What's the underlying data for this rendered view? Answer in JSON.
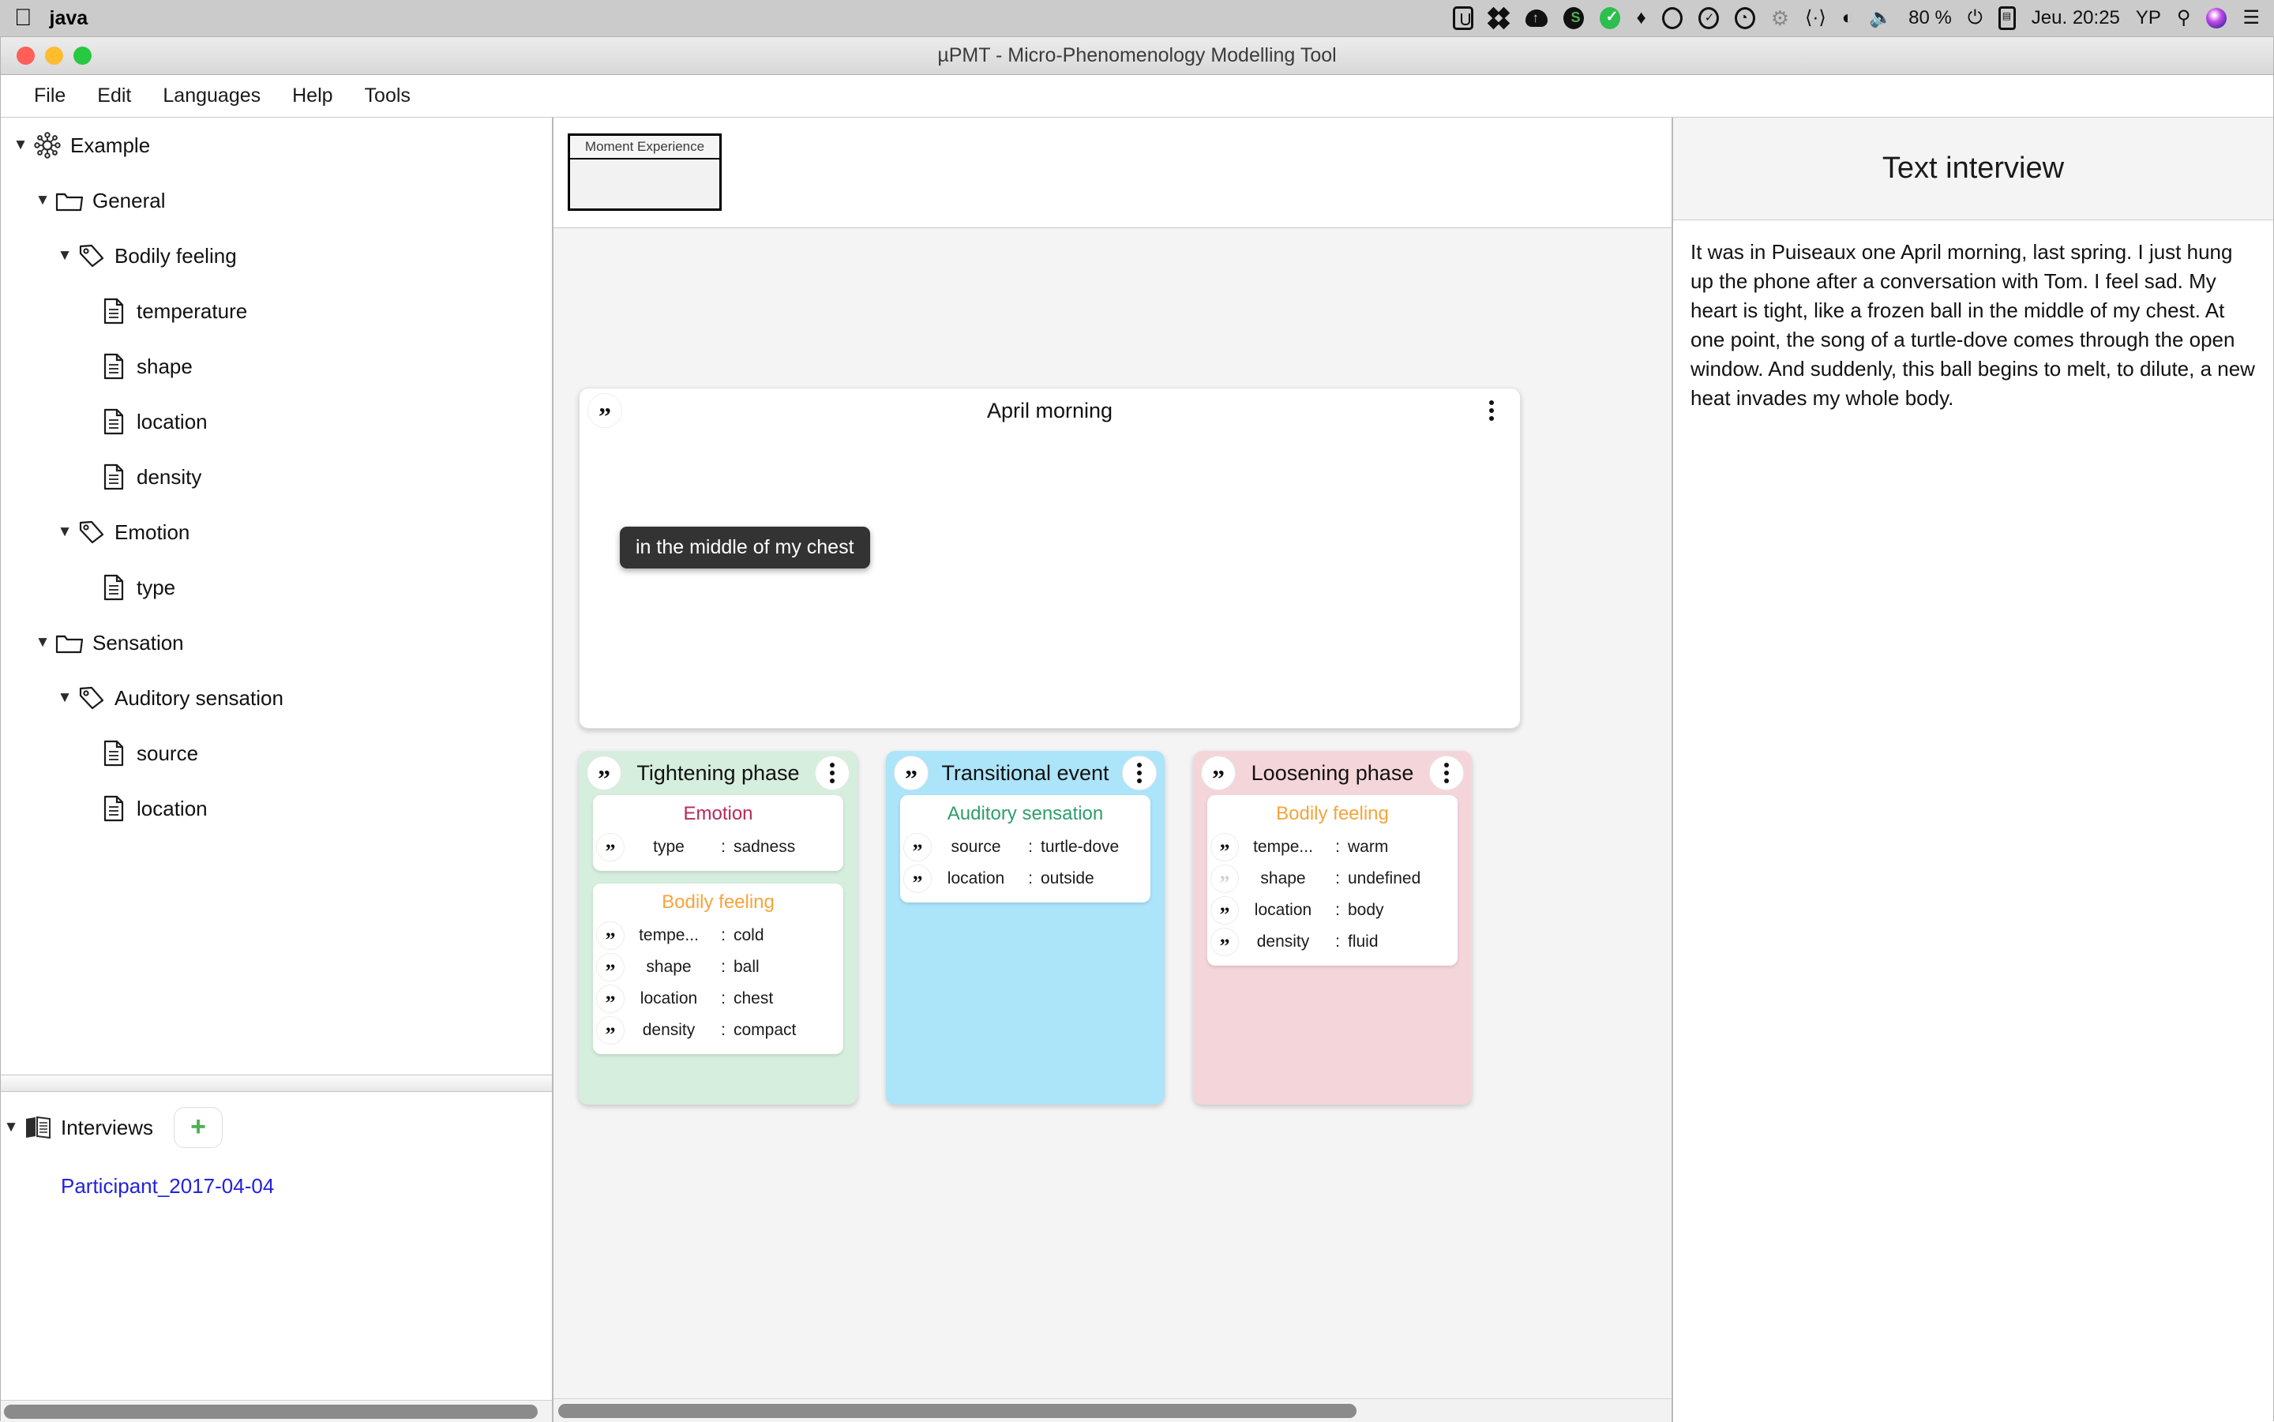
{
  "menubar": {
    "apple_glyph": "",
    "app_name": "java",
    "tray": {
      "battery": "80 %",
      "clock": "Jeu. 20:25",
      "user": "YP",
      "icons": [
        "stage-manager-icon",
        "dropbox-icon",
        "cloud-upload-icon",
        "evernote-icon",
        "check-green-icon",
        "elephant-icon",
        "swirl-icon",
        "checkbox-circle-icon",
        "time-machine-icon",
        "bluetooth-icon",
        "code-brackets-icon",
        "wifi-icon",
        "volume-icon",
        "battery-icon",
        "calculator-icon",
        "search-icon",
        "siri-icon",
        "control-center-icon"
      ]
    }
  },
  "window": {
    "title": "µPMT - Micro-Phenomenology Modelling Tool",
    "traffic_lights": [
      "close-button",
      "minimize-button",
      "zoom-button"
    ],
    "menu": [
      "File",
      "Edit",
      "Languages",
      "Help",
      "Tools"
    ]
  },
  "sidebar": {
    "tree": [
      {
        "label": "Example",
        "icon": "network-icon",
        "depth": 0,
        "arrow": "▼"
      },
      {
        "label": "General",
        "icon": "folder-icon",
        "depth": 1,
        "arrow": "▼"
      },
      {
        "label": "Bodily feeling",
        "icon": "tag-icon",
        "depth": 2,
        "arrow": "▼"
      },
      {
        "label": "temperature",
        "icon": "file-icon",
        "depth": 3,
        "arrow": ""
      },
      {
        "label": "shape",
        "icon": "file-icon",
        "depth": 3,
        "arrow": ""
      },
      {
        "label": "location",
        "icon": "file-icon",
        "depth": 3,
        "arrow": ""
      },
      {
        "label": "density",
        "icon": "file-icon",
        "depth": 3,
        "arrow": ""
      },
      {
        "label": "Emotion",
        "icon": "tag-icon",
        "depth": 2,
        "arrow": "▼"
      },
      {
        "label": "type",
        "icon": "file-icon",
        "depth": 3,
        "arrow": ""
      },
      {
        "label": "Sensation",
        "icon": "folder-icon",
        "depth": 1,
        "arrow": "▼"
      },
      {
        "label": "Auditory sensation",
        "icon": "tag-icon",
        "depth": 2,
        "arrow": "▼"
      },
      {
        "label": "source",
        "icon": "file-icon",
        "depth": 3,
        "arrow": ""
      },
      {
        "label": "location",
        "icon": "file-icon",
        "depth": 3,
        "arrow": ""
      }
    ],
    "interviews": {
      "arrow": "▼",
      "icon": "book-icon",
      "label": "Interviews",
      "add_button": "+",
      "items": [
        {
          "label": "Participant_2017-04-04",
          "color": "#2222dd"
        }
      ]
    }
  },
  "canvas": {
    "minimap": {
      "label": "Moment Experience"
    },
    "moment_card": {
      "title": "April morning",
      "quote_icon": "quote-icon",
      "menu_icon": "kebab-menu-icon"
    },
    "phases": [
      {
        "title": "Tightening phase",
        "color": "#d6eedd",
        "groups": [
          {
            "name": "Emotion",
            "color": "#b8295a",
            "props": [
              {
                "key": "type",
                "value": "sadness",
                "quote": true
              }
            ]
          },
          {
            "name": "Bodily feeling",
            "color": "#f5a43c",
            "props": [
              {
                "key": "tempe...",
                "value": "cold",
                "quote": true
              },
              {
                "key": "shape",
                "value": "ball",
                "quote": true
              },
              {
                "key": "location",
                "value": "chest",
                "quote": true
              },
              {
                "key": "density",
                "value": "compact",
                "quote": true
              }
            ]
          }
        ]
      },
      {
        "title": "Transitional event",
        "color": "#ace4fa",
        "groups": [
          {
            "name": "Auditory sensation",
            "color": "#2e9e6b",
            "props": [
              {
                "key": "source",
                "value": "turtle-dove",
                "quote": true
              },
              {
                "key": "location",
                "value": "outside",
                "quote": true
              }
            ]
          }
        ]
      },
      {
        "title": "Loosening phase",
        "color": "#f4d6da",
        "groups": [
          {
            "name": "Bodily feeling",
            "color": "#f5a43c",
            "props": [
              {
                "key": "tempe...",
                "value": "warm",
                "quote": true
              },
              {
                "key": "shape",
                "value": "undefined",
                "quote": false
              },
              {
                "key": "location",
                "value": "body",
                "quote": true
              },
              {
                "key": "density",
                "value": "fluid",
                "quote": true
              }
            ]
          }
        ]
      }
    ],
    "tooltip": {
      "text": "in the middle of my chest"
    }
  },
  "right_panel": {
    "title": "Text interview",
    "text": "It was in Puiseaux one April morning, last spring. I just hung up the phone after a conversation with Tom. I feel sad. My heart is tight, like a frozen ball in the middle of my chest. At one point, the song of a turtle-dove comes through the open window. And suddenly, this ball begins to melt, to dilute, a new heat invades my whole body."
  },
  "colors": {
    "phase_green": "#d6eedd",
    "phase_blue": "#ace4fa",
    "phase_pink": "#f4d6da",
    "emotion_label": "#b8295a",
    "bodily_label": "#f5a43c",
    "auditory_label": "#2e9e6b",
    "link": "#2222dd"
  }
}
